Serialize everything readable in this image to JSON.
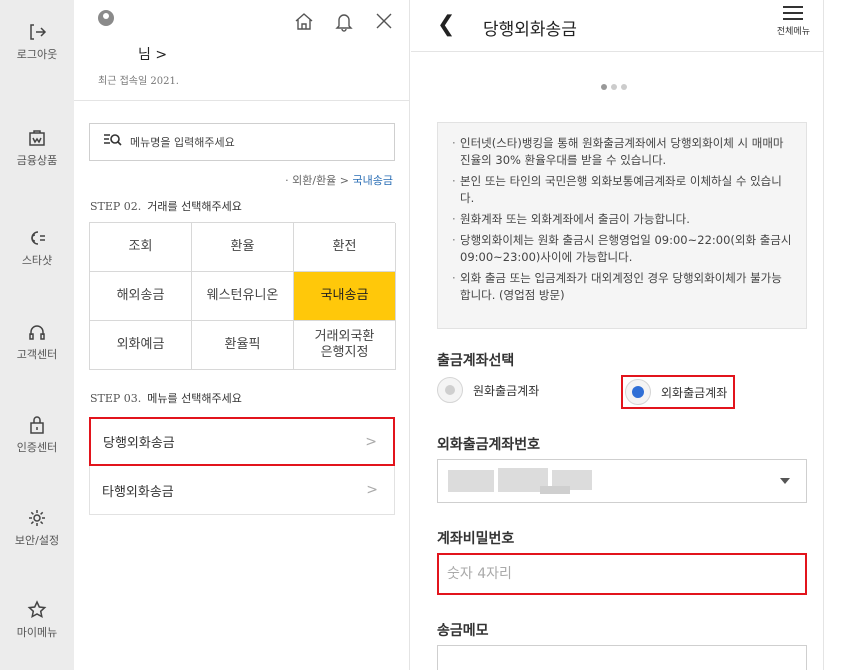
{
  "sidebar": {
    "items": [
      {
        "icon": "logout-icon",
        "label": "로그아웃"
      },
      {
        "icon": "product-icon",
        "label": "금융상품"
      },
      {
        "icon": "chatbot-icon",
        "label": "스타샷"
      },
      {
        "icon": "headset-icon",
        "label": "고객센터"
      },
      {
        "icon": "lock-icon",
        "label": "인증센터"
      },
      {
        "icon": "gear-icon",
        "label": "보안/설정"
      },
      {
        "icon": "star-icon",
        "label": "마이메뉴"
      }
    ]
  },
  "menu_panel": {
    "user_name": "님 >",
    "last_login": "최근 접속일 2021.",
    "search_placeholder": "메뉴명을 입력해주세요",
    "breadcrumb_prefix": "· 외환/환율 > ",
    "breadcrumb_current": "국내송금",
    "step2_num": "STEP 02.",
    "step2_text": "거래를 선택해주세요",
    "grid": [
      "조회",
      "환율",
      "환전",
      "해외송금",
      "웨스턴유니온",
      "국내송금",
      "외화예금",
      "환율픽",
      "거래외국환\n은행지정"
    ],
    "grid_active": "국내송금",
    "step3_num": "STEP 03.",
    "step3_text": "메뉴를 선택해주세요",
    "menu_items": [
      "당행외화송금",
      "타행외화송금"
    ]
  },
  "detail": {
    "title": "당행외화송금",
    "menu_label": "전체메뉴",
    "notices": [
      "인터넷(스타)뱅킹을 통해 원화출금계좌에서 당행외화이체 시 매매마진율의 30% 환율우대를 받을 수 있습니다.",
      "본인 또는 타인의 국민은행 외화보통예금계좌로 이체하실 수 있습니다.",
      "원화계좌 또는 외화계좌에서 출금이 가능합니다.",
      "당행외화이체는 원화 출금시 은행영업일 09:00~22:00(외화 출금시 09:00~23:00)사이에 가능합니다.",
      "외화 출금 또는 입금계좌가 대외계정인 경우 당행외화이체가 불가능합니다. (영업점 방문)"
    ],
    "withdraw_section": "출금계좌선택",
    "radio_krw": "원화출금계좌",
    "radio_fx": "외화출금계좌",
    "selected_radio": "외화출금계좌",
    "account_section": "외화출금계좌번호",
    "password_section": "계좌비밀번호",
    "password_placeholder": "숫자 4자리",
    "memo_section": "송금메모"
  },
  "colors": {
    "accent_yellow": "#ffc80a",
    "highlight_red": "#e2141c",
    "radio_blue": "#2f6fd6",
    "link_blue": "#2a6eb5"
  }
}
